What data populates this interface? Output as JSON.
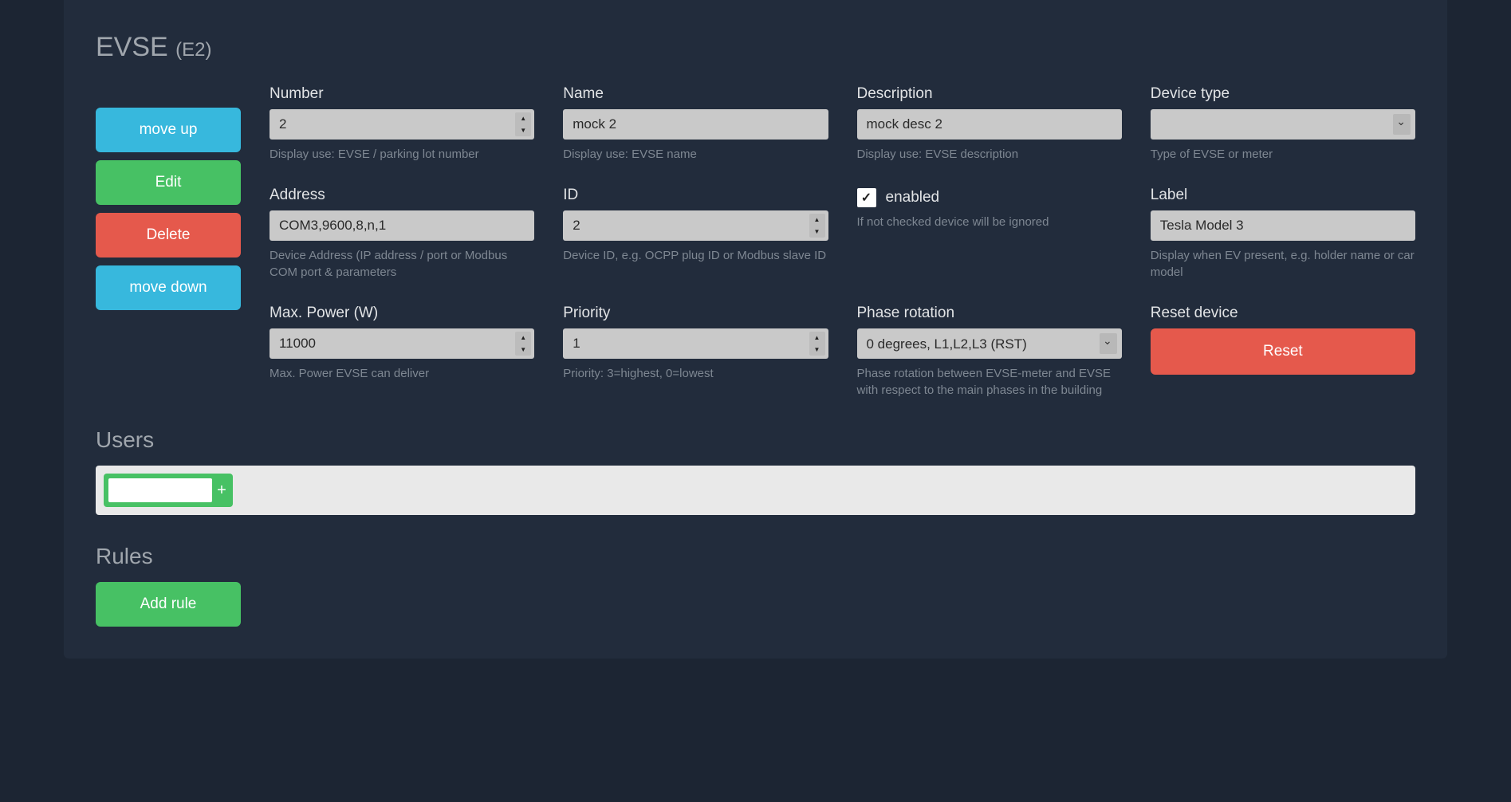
{
  "title": {
    "main": "EVSE",
    "suffix": "(E2)"
  },
  "sidebtn": {
    "move_up": "move up",
    "edit": "Edit",
    "delete": "Delete",
    "move_down": "move down"
  },
  "fields": {
    "number": {
      "label": "Number",
      "value": "2",
      "help": "Display use: EVSE / parking lot number"
    },
    "name": {
      "label": "Name",
      "value": "mock 2",
      "help": "Display use: EVSE name"
    },
    "description": {
      "label": "Description",
      "value": "mock desc 2",
      "help": "Display use: EVSE description"
    },
    "device_type": {
      "label": "Device type",
      "value": "",
      "help": "Type of EVSE or meter"
    },
    "address": {
      "label": "Address",
      "value": "COM3,9600,8,n,1",
      "help": "Device Address (IP address / port or Modbus COM port & parameters"
    },
    "id": {
      "label": "ID",
      "value": "2",
      "help": "Device ID, e.g. OCPP plug ID or Modbus slave ID"
    },
    "enabled": {
      "label": "enabled",
      "checked": true,
      "help": "If not checked device will be ignored"
    },
    "label_f": {
      "label": "Label",
      "value": "Tesla Model 3",
      "help": "Display when EV present, e.g. holder name or car model"
    },
    "max_power": {
      "label": "Max. Power (W)",
      "value": "11000",
      "help": "Max. Power EVSE can deliver"
    },
    "priority": {
      "label": "Priority",
      "value": "1",
      "help": "Priority: 3=highest, 0=lowest"
    },
    "phase_rot": {
      "label": "Phase rotation",
      "value": "0 degrees, L1,L2,L3 (RST)",
      "help": "Phase rotation between EVSE-meter and EVSE with respect to the main phases in the building"
    },
    "reset": {
      "label": "Reset device",
      "button": "Reset"
    }
  },
  "sections": {
    "users": "Users",
    "rules": "Rules",
    "add_rule": "Add rule"
  },
  "users_input": ""
}
